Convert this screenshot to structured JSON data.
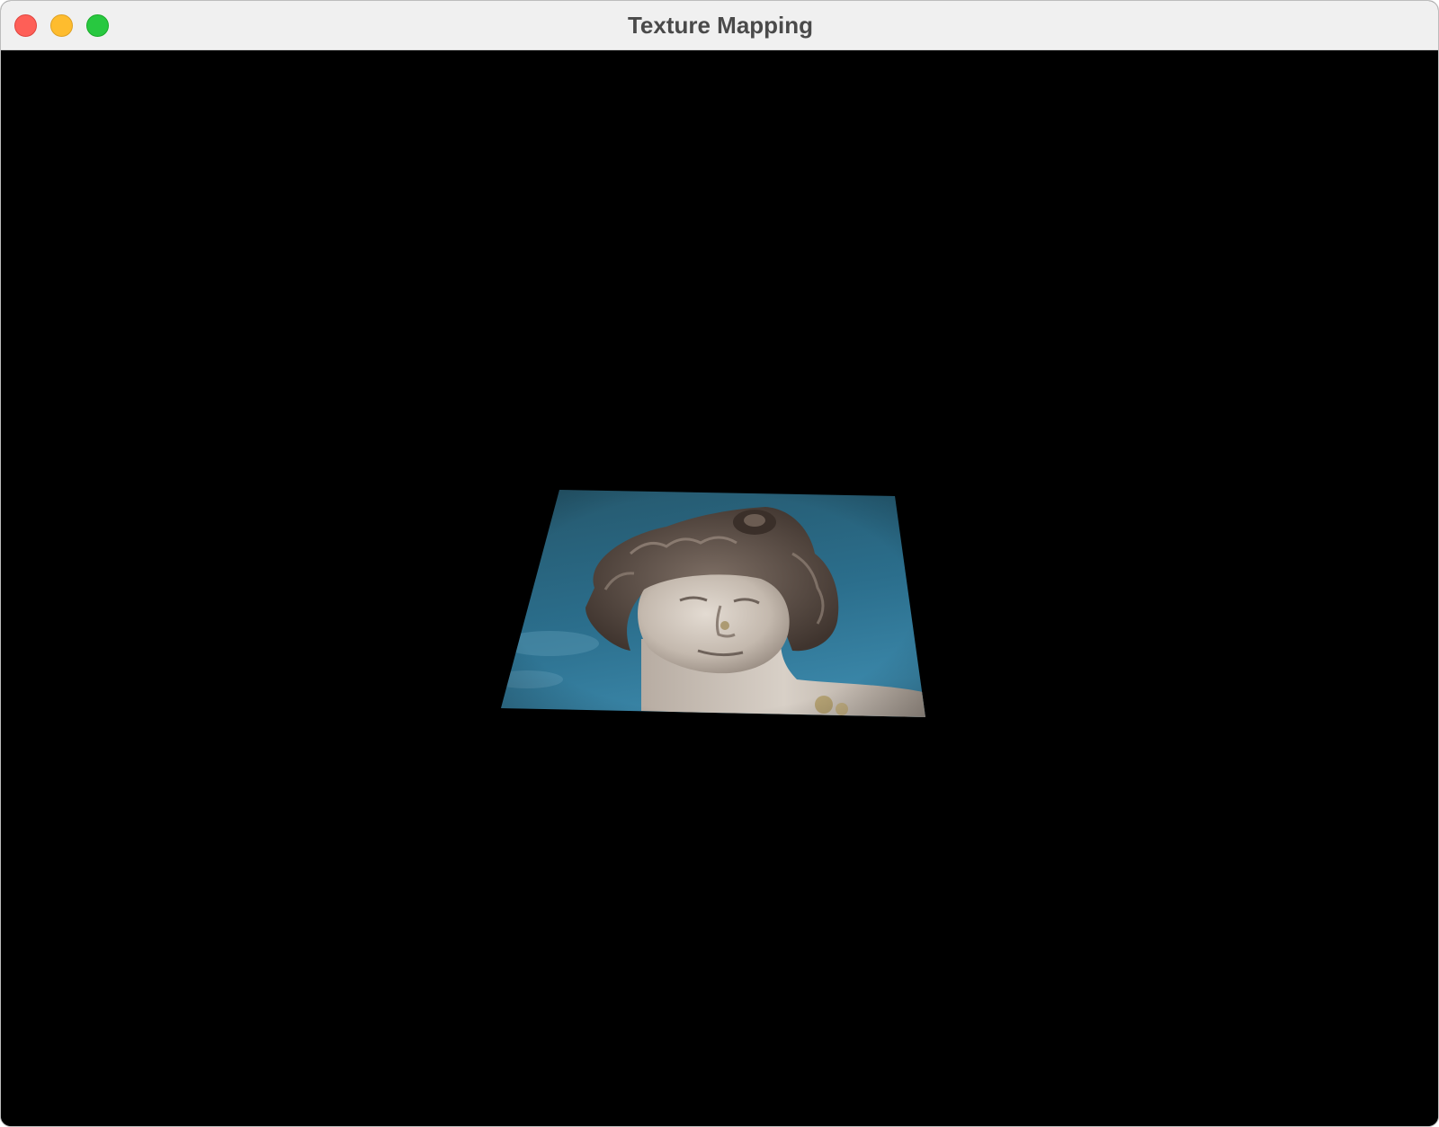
{
  "window": {
    "title": "Texture Mapping",
    "controls": {
      "close_color": "#fe5f57",
      "minimize_color": "#febc2e",
      "zoom_color": "#28c840"
    }
  },
  "scene": {
    "background_color": "#000000",
    "texture": {
      "subject": "statue-head-against-blue-sky",
      "sky_color_top": "#25566a",
      "sky_color_bottom": "#2f7a9c",
      "stone_color": "#c9bfb4",
      "hair_color": "#5e5048"
    }
  }
}
